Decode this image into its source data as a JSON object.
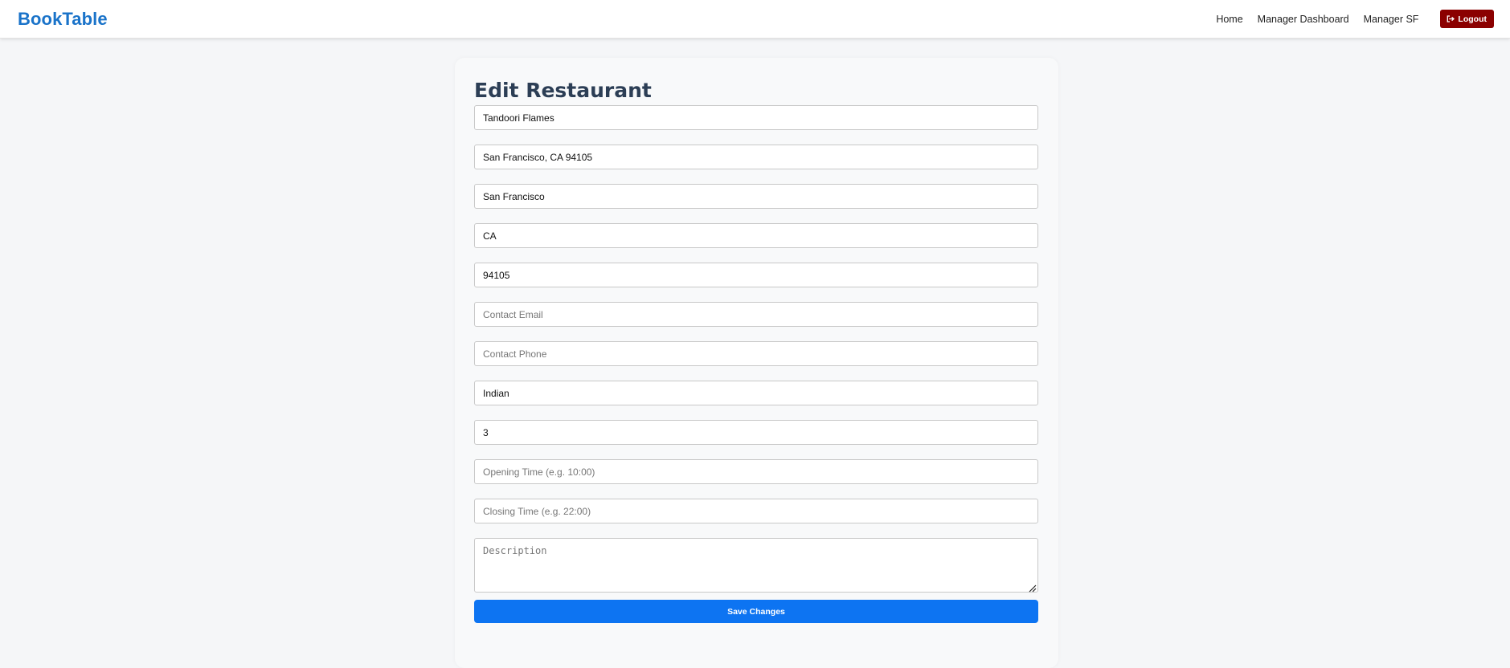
{
  "navbar": {
    "brand": "BookTable",
    "links": [
      "Home",
      "Manager Dashboard"
    ],
    "user": "Manager SF",
    "logout_label": "Logout",
    "logout_icon": "sign-out-icon"
  },
  "form": {
    "title": "Edit Restaurant",
    "fields": [
      {
        "name": "restaurant-name",
        "value": "Tandoori Flames",
        "placeholder": ""
      },
      {
        "name": "address",
        "value": "San Francisco, CA 94105",
        "placeholder": ""
      },
      {
        "name": "city",
        "value": "San Francisco",
        "placeholder": ""
      },
      {
        "name": "state",
        "value": "CA",
        "placeholder": ""
      },
      {
        "name": "zip",
        "value": "94105",
        "placeholder": ""
      },
      {
        "name": "contact-email",
        "value": "",
        "placeholder": "Contact Email"
      },
      {
        "name": "contact-phone",
        "value": "",
        "placeholder": "Contact Phone"
      },
      {
        "name": "cuisine",
        "value": "Indian",
        "placeholder": ""
      },
      {
        "name": "price-level",
        "value": "3",
        "placeholder": ""
      },
      {
        "name": "opening-time",
        "value": "",
        "placeholder": "Opening Time (e.g. 10:00)"
      },
      {
        "name": "closing-time",
        "value": "",
        "placeholder": "Closing Time (e.g. 22:00)"
      }
    ],
    "description": {
      "value": "",
      "placeholder": "Description"
    },
    "save_label": "Save Changes"
  },
  "colors": {
    "brand": "#1a73c9",
    "logout_bg": "#8b0000",
    "save_bg": "#0d74f2",
    "title": "#2c3e55",
    "page_bg": "#f5f6f8"
  }
}
